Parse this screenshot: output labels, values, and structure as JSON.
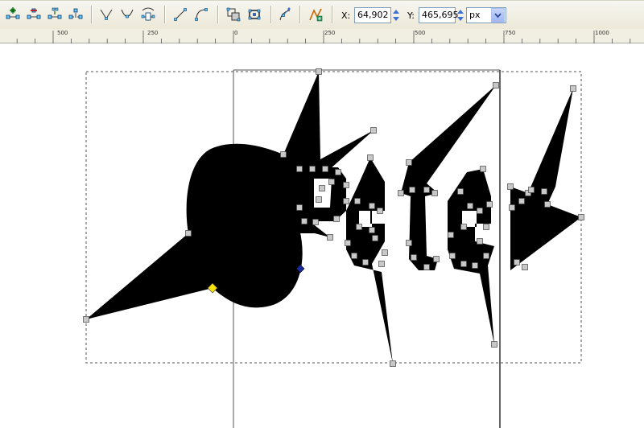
{
  "toolbar": {
    "node_tools": [
      "insert-node-icon",
      "delete-node-icon",
      "join-nodes-icon",
      "break-path-icon",
      "cusp-node-icon",
      "smooth-node-icon",
      "symmetric-node-icon",
      "line-segment-icon",
      "curve-segment-icon",
      "object-to-path-icon",
      "stroke-to-path-icon",
      "show-handles-icon",
      "path-effect-icon"
    ],
    "x_label": "X:",
    "x_value": "64,902",
    "y_label": "Y:",
    "y_value": "465,695",
    "unit": "px"
  },
  "ruler": {
    "labels": [
      "500",
      "250",
      "0",
      "250",
      "500",
      "750",
      "1000"
    ]
  },
  "canvas": {
    "fill_color": "#000000",
    "selected_node_color": "#f5e20a",
    "handle_color": "#1a2a9a",
    "node_color": "#c8c8c8"
  }
}
